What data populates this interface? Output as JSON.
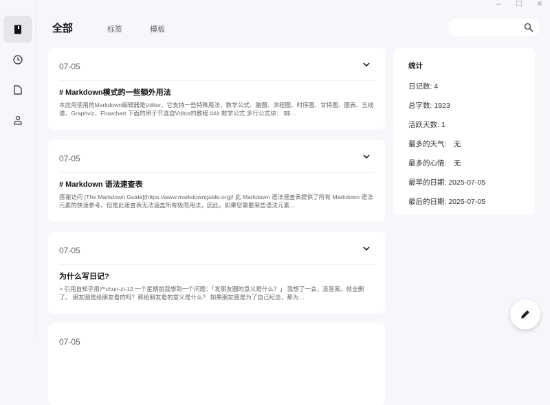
{
  "window": {
    "minimize": "–",
    "maximize": "☐",
    "close": "✕"
  },
  "tabs": [
    {
      "label": "全部"
    },
    {
      "label": "标签"
    },
    {
      "label": "模板"
    }
  ],
  "search": {
    "placeholder": ""
  },
  "entries": [
    {
      "date": "07-05",
      "title": "# Markdown模式的一些额外用法",
      "excerpt": "本应用使用的Markdown编辑器是Vditor，它支持一些特殊用法，数学公式、脑图、流程图、时序图、甘特图、图表、五线谱、Graphviz、Flowchart 下面的例子节选自Vditor的教程 ### 数学公式 多行公式块： $$…"
    },
    {
      "date": "07-05",
      "title": "# Markdown 语法速查表",
      "excerpt": "感谢访问 [The Markdown Guide](https://www.markdownguide.org)! 此 Markdown 语法速查表提供了所有 Markdown 语法元素的快速参考。但是此速查表无法涵盖所有极限用法，因此，如果您需要某些语法元素…"
    },
    {
      "date": "07-05",
      "title": "为什么写日记?",
      "excerpt": "> 引用自知乎用户chun-zi-12 一个星期前我想到一个问题：「发朋友圈的意义是什么？」 我想了一会，没答案。就全删了。 朋友圈是给朋友看的吗？那给朋友看的意义是什么？ 如果朋友圈是为了自己纪念，那为…"
    },
    {
      "date": "07-05"
    }
  ],
  "stats": {
    "title": "统计",
    "rows": [
      "日记数: 4",
      "总字数: 1923",
      "活跃天数: 1",
      "最多的天气:　无",
      "最多的心情:　无",
      "最早的日期: 2025-07-05",
      "最后的日期: 2025-07-05"
    ]
  }
}
